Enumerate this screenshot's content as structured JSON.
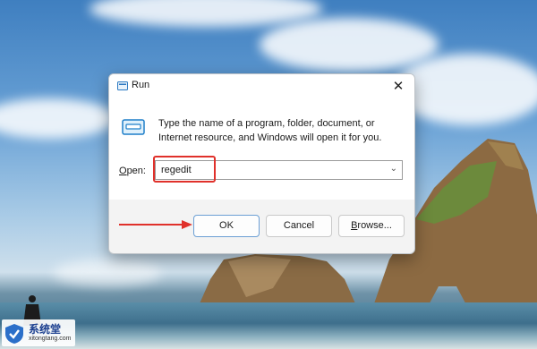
{
  "dialog": {
    "title": "Run",
    "close_glyph": "✕",
    "description": "Type the name of a program, folder, document, or Internet resource, and Windows will open it for you.",
    "open_label_prefix": "O",
    "open_label_suffix": "pen:",
    "input_value": "regedit",
    "dropdown_glyph": "⌄",
    "buttons": {
      "ok": "OK",
      "cancel": "Cancel",
      "browse_prefix": "B",
      "browse_suffix": "rowse..."
    }
  },
  "watermark": {
    "brand": "系统堂",
    "url": "xitongtang.com"
  },
  "colors": {
    "annotation": "#e0312b",
    "dialog_bg": "#f3f3f3",
    "accent": "#6c9fd4"
  },
  "icons": [
    "run-app-icon",
    "run-program-icon",
    "close-icon",
    "chevron-down-icon",
    "shield-logo-icon",
    "arrow-icon"
  ]
}
